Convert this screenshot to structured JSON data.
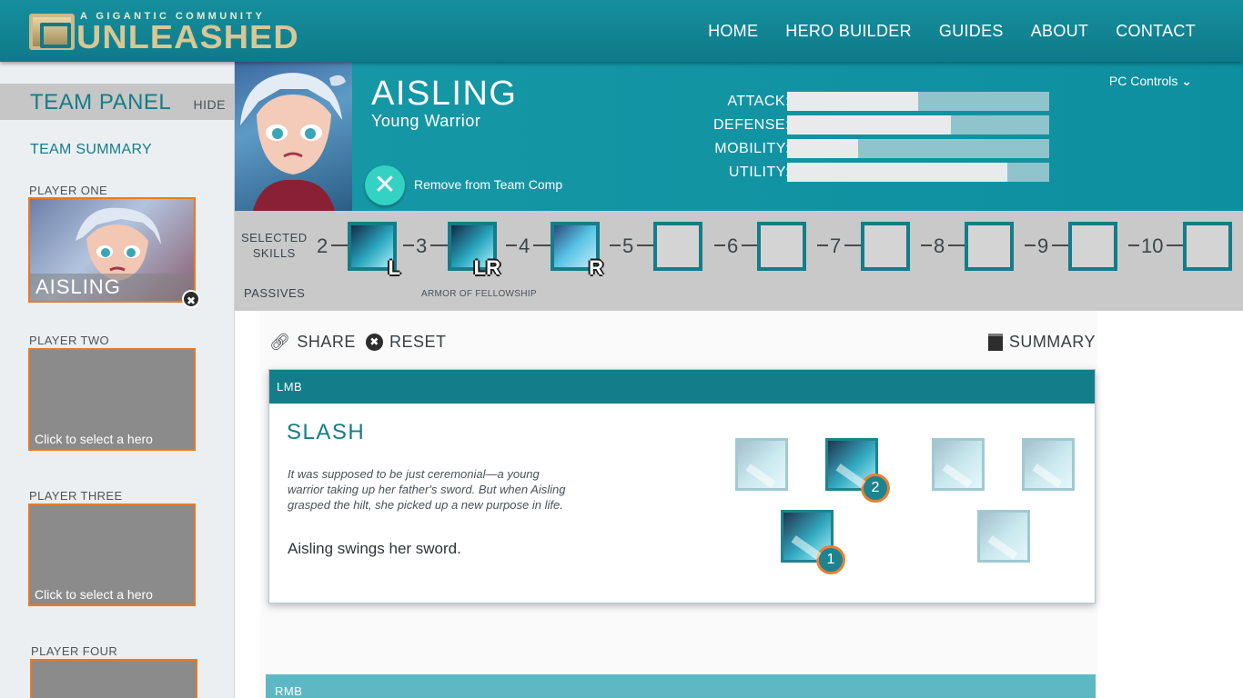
{
  "header": {
    "logo_subtitle": "A GIGANTIC COMMUNITY",
    "logo_title": "UNLEASHED",
    "nav": [
      {
        "label": "HOME"
      },
      {
        "label": "HERO BUILDER"
      },
      {
        "label": "GUIDES"
      },
      {
        "label": "ABOUT"
      },
      {
        "label": "CONTACT"
      }
    ]
  },
  "team_panel": {
    "title": "TEAM PANEL",
    "hide_label": "HIDE",
    "summary_label": "TEAM SUMMARY",
    "players": [
      {
        "label": "PLAYER ONE",
        "hero": "AISLING"
      },
      {
        "label": "PLAYER TWO",
        "hint": "Click to select a hero"
      },
      {
        "label": "PLAYER THREE",
        "hint": "Click to select a hero"
      },
      {
        "label": "PLAYER FOUR"
      }
    ]
  },
  "hero": {
    "name": "AISLING",
    "subtitle": "Young Warrior",
    "remove_label": "Remove from Team Comp",
    "controls_label": "PC Controls",
    "stats": [
      {
        "label": "ATTACK:",
        "value": 0.5
      },
      {
        "label": "DEFENSE:",
        "value": 0.625
      },
      {
        "label": "MOBILITY:",
        "value": 0.27
      },
      {
        "label": "UTILITY:",
        "value": 0.84
      }
    ]
  },
  "skills": {
    "selected_label": "SELECTED SKILLS",
    "selected_label_line1": "SELECTED",
    "selected_label_line2": "SKILLS",
    "passives_label": "PASSIVES",
    "passive_name": "ARMOR OF FELLOWSHIP",
    "levels": [
      "2",
      "3",
      "4",
      "5",
      "6",
      "7",
      "8",
      "9",
      "10"
    ],
    "slots": [
      {
        "key": "L",
        "filled": true,
        "icon": "sword-slash-icon"
      },
      {
        "key": "LR",
        "filled": true,
        "icon": "sword-slash-icon"
      },
      {
        "key": "R",
        "filled": true,
        "icon": "crystal-shield-icon"
      },
      {
        "key": "",
        "filled": false
      },
      {
        "key": "",
        "filled": false
      },
      {
        "key": "",
        "filled": false
      },
      {
        "key": "",
        "filled": false
      },
      {
        "key": "",
        "filled": false
      },
      {
        "key": "",
        "filled": false
      }
    ]
  },
  "actions": {
    "share": "SHARE",
    "reset": "RESET",
    "summary": "SUMMARY"
  },
  "lmb_card": {
    "tab": "LMB",
    "title": "SLASH",
    "lore": "It was supposed to be just ceremonial—a young warrior taking up her father's sword. But when Aisling grasped the hilt, she picked up a new purpose in life.",
    "description": "Aisling swings her sword.",
    "ranks": [
      "2",
      "1"
    ]
  },
  "rmb_card": {
    "tab": "RMB"
  },
  "colors": {
    "accent": "#137d8a",
    "highlight": "#e97a25",
    "teal_button": "#33d2c4"
  }
}
